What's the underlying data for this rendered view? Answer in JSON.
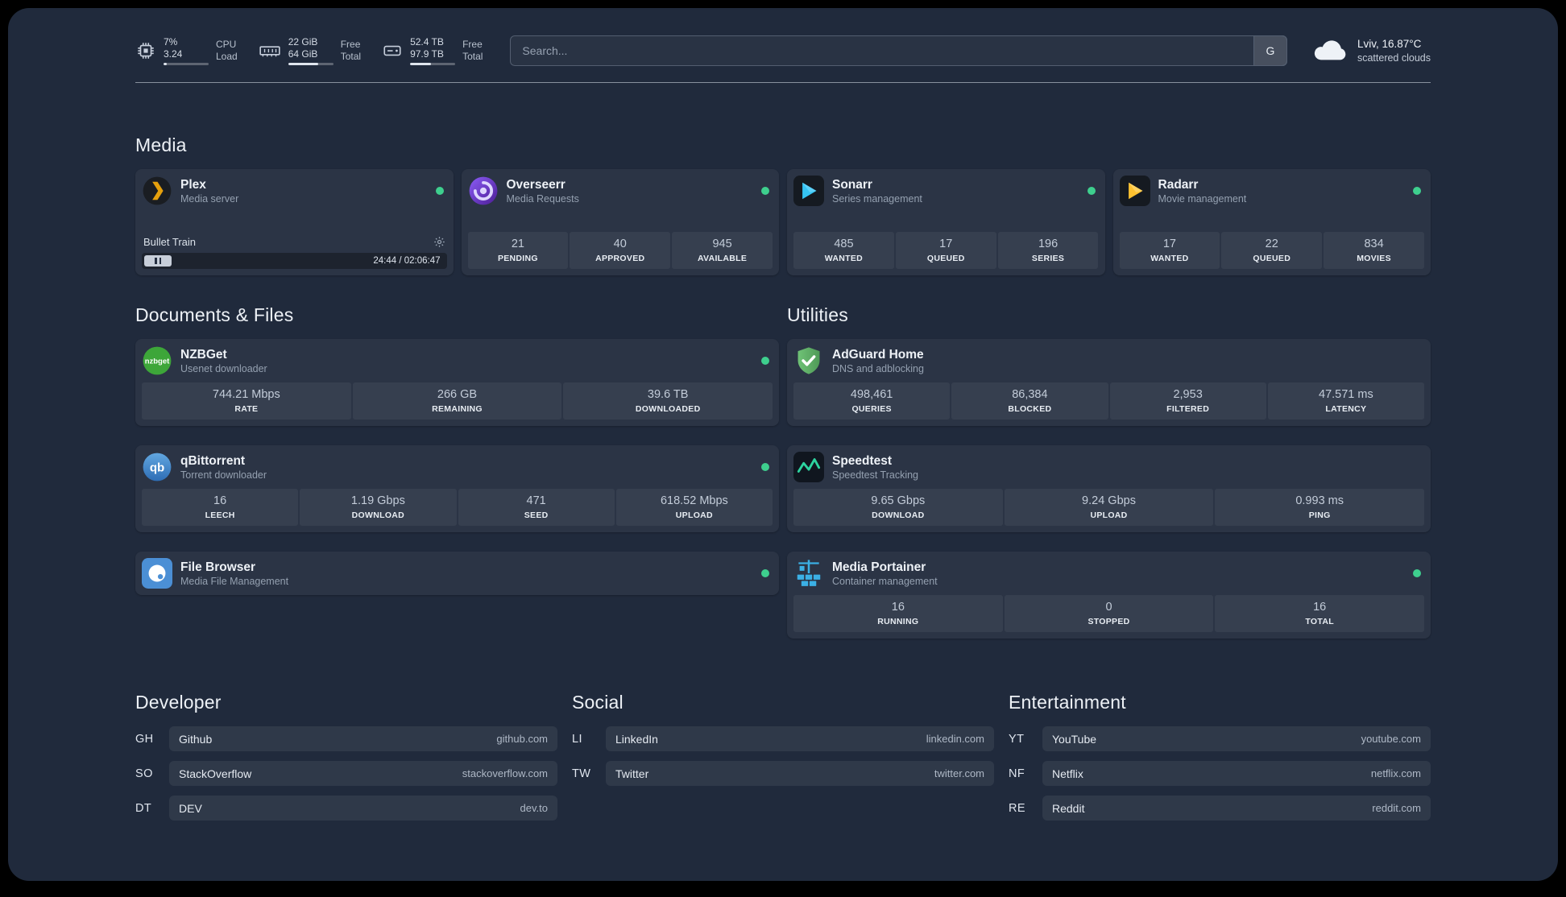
{
  "topbar": {
    "cpu": {
      "value_top": "7%",
      "value_bottom": "3.24",
      "label_top": "CPU",
      "label_bottom": "Load",
      "bar_pct": 7
    },
    "memory": {
      "value_top": "22 GiB",
      "value_bottom": "64 GiB",
      "label_top": "Free",
      "label_bottom": "Total",
      "bar_pct": 66
    },
    "disk": {
      "value_top": "52.4 TB",
      "value_bottom": "97.9 TB",
      "label_top": "Free",
      "label_bottom": "Total",
      "bar_pct": 46
    },
    "search": {
      "placeholder": "Search...",
      "provider_button": "G"
    },
    "weather": {
      "location": "Lviv, 16.87°C",
      "condition": "scattered clouds"
    }
  },
  "colors": {
    "status_online": "#3ecf8e",
    "background": "#202a3c",
    "plex_accent": "#e5a00d",
    "sonarr_accent": "#35c5f4",
    "radarr_accent": "#ffc230",
    "speedtest_accent": "#2dd4a0"
  },
  "sections": {
    "media": {
      "title": "Media",
      "plex": {
        "name": "Plex",
        "subtitle": "Media server",
        "status": "online",
        "now_playing": {
          "title": "Bullet Train",
          "time_display": "24:44 / 02:06:47",
          "progress_pct": 19.5,
          "state": "paused"
        }
      },
      "overseerr": {
        "name": "Overseerr",
        "subtitle": "Media Requests",
        "status": "online",
        "stats": [
          {
            "value": "21",
            "label": "PENDING"
          },
          {
            "value": "40",
            "label": "APPROVED"
          },
          {
            "value": "945",
            "label": "AVAILABLE"
          }
        ]
      },
      "sonarr": {
        "name": "Sonarr",
        "subtitle": "Series management",
        "status": "online",
        "stats": [
          {
            "value": "485",
            "label": "WANTED"
          },
          {
            "value": "17",
            "label": "QUEUED"
          },
          {
            "value": "196",
            "label": "SERIES"
          }
        ]
      },
      "radarr": {
        "name": "Radarr",
        "subtitle": "Movie management",
        "status": "online",
        "stats": [
          {
            "value": "17",
            "label": "WANTED"
          },
          {
            "value": "22",
            "label": "QUEUED"
          },
          {
            "value": "834",
            "label": "MOVIES"
          }
        ]
      }
    },
    "documents": {
      "title": "Documents & Files",
      "nzbget": {
        "name": "NZBGet",
        "subtitle": "Usenet downloader",
        "status": "online",
        "stats": [
          {
            "value": "744.21 Mbps",
            "label": "RATE"
          },
          {
            "value": "266 GB",
            "label": "REMAINING"
          },
          {
            "value": "39.6 TB",
            "label": "DOWNLOADED"
          }
        ]
      },
      "qbittorrent": {
        "name": "qBittorrent",
        "subtitle": "Torrent downloader",
        "status": "online",
        "stats": [
          {
            "value": "16",
            "label": "LEECH"
          },
          {
            "value": "1.19 Gbps",
            "label": "DOWNLOAD"
          },
          {
            "value": "471",
            "label": "SEED"
          },
          {
            "value": "618.52 Mbps",
            "label": "UPLOAD"
          }
        ]
      },
      "filebrowser": {
        "name": "File Browser",
        "subtitle": "Media File Management",
        "status": "online"
      }
    },
    "utilities": {
      "title": "Utilities",
      "adguard": {
        "name": "AdGuard Home",
        "subtitle": "DNS and adblocking",
        "stats": [
          {
            "value": "498,461",
            "label": "QUERIES"
          },
          {
            "value": "86,384",
            "label": "BLOCKED"
          },
          {
            "value": "2,953",
            "label": "FILTERED"
          },
          {
            "value": "47.571 ms",
            "label": "LATENCY"
          }
        ]
      },
      "speedtest": {
        "name": "Speedtest",
        "subtitle": "Speedtest Tracking",
        "stats": [
          {
            "value": "9.65 Gbps",
            "label": "DOWNLOAD"
          },
          {
            "value": "9.24 Gbps",
            "label": "UPLOAD"
          },
          {
            "value": "0.993 ms",
            "label": "PING"
          }
        ]
      },
      "portainer": {
        "name": "Media Portainer",
        "subtitle": "Container management",
        "status": "online",
        "stats": [
          {
            "value": "16",
            "label": "RUNNING"
          },
          {
            "value": "0",
            "label": "STOPPED"
          },
          {
            "value": "16",
            "label": "TOTAL"
          }
        ]
      }
    },
    "developer": {
      "title": "Developer",
      "links": [
        {
          "abbr": "GH",
          "name": "Github",
          "url": "github.com"
        },
        {
          "abbr": "SO",
          "name": "StackOverflow",
          "url": "stackoverflow.com"
        },
        {
          "abbr": "DT",
          "name": "DEV",
          "url": "dev.to"
        }
      ]
    },
    "social": {
      "title": "Social",
      "links": [
        {
          "abbr": "LI",
          "name": "LinkedIn",
          "url": "linkedin.com"
        },
        {
          "abbr": "TW",
          "name": "Twitter",
          "url": "twitter.com"
        }
      ]
    },
    "entertainment": {
      "title": "Entertainment",
      "links": [
        {
          "abbr": "YT",
          "name": "YouTube",
          "url": "youtube.com"
        },
        {
          "abbr": "NF",
          "name": "Netflix",
          "url": "netflix.com"
        },
        {
          "abbr": "RE",
          "name": "Reddit",
          "url": "reddit.com"
        }
      ]
    }
  }
}
